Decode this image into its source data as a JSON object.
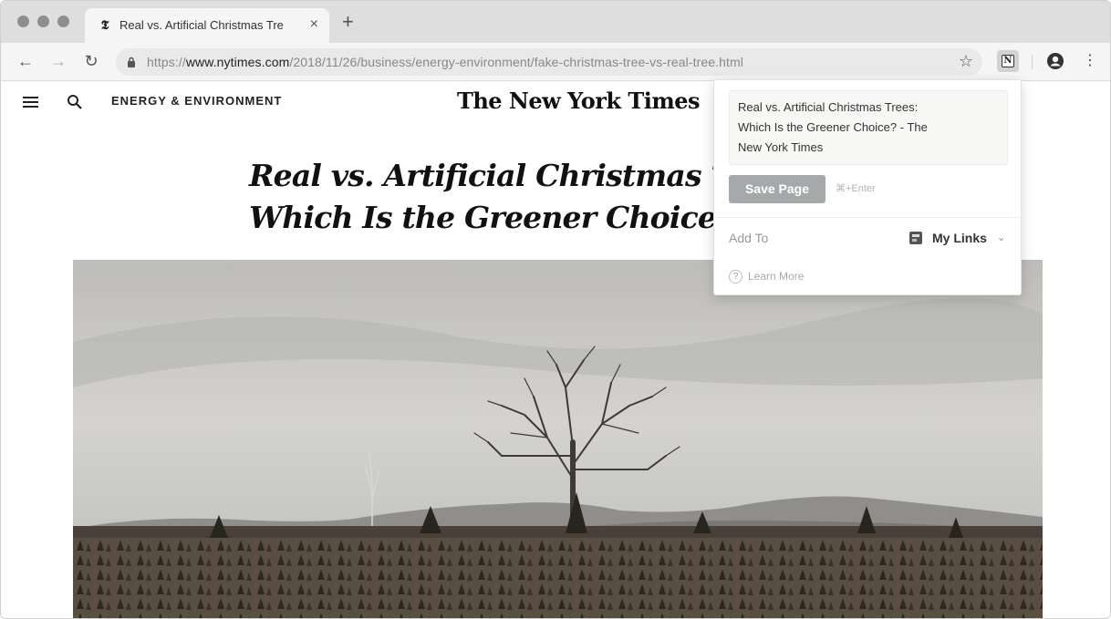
{
  "browser": {
    "tab_title": "Real vs. Artificial Christmas Tre",
    "tab_favicon": "𝕿",
    "tab_close": "×",
    "new_tab": "+",
    "url_scheme": "https://",
    "url_host": "www.nytimes.com",
    "url_path": "/2018/11/26/business/energy-environment/fake-christmas-tree-vs-real-tree.html",
    "icons": {
      "back": "←",
      "forward": "→",
      "reload": "↻",
      "star": "☆",
      "menu": "⋮"
    }
  },
  "page": {
    "section": "ENERGY & ENVIRONMENT",
    "masthead": "The New York Times",
    "headline_line1": "Real vs. Artificial Christmas Trees:",
    "headline_line2": "Which Is the Greener Choice?"
  },
  "popup": {
    "title_value": "Real vs. Artificial Christmas Trees:\nWhich Is the Greener Choice? - The\nNew York Times",
    "save_label": "Save Page",
    "shortcut": "⌘+Enter",
    "add_to_label": "Add To",
    "workspace_label": "My Links",
    "chevron": "⌄",
    "help_glyph": "?",
    "learn_more": "Learn More"
  }
}
